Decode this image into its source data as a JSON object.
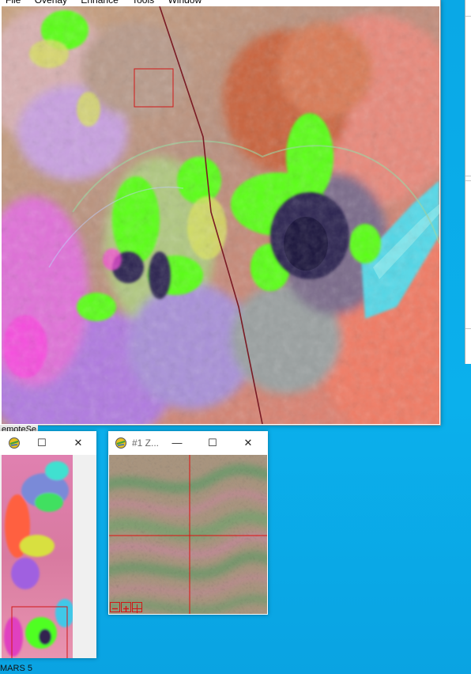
{
  "menu": {
    "items": [
      "File",
      "Overlay",
      "Enhance",
      "Tools",
      "Window"
    ]
  },
  "scroll_window": {
    "controls": {
      "minimize": "—",
      "maximize": "☐",
      "close": "✕"
    }
  },
  "zoom_window": {
    "title": "#1 Z...",
    "controls": {
      "minimize": "—",
      "maximize": "☐",
      "close": "✕"
    }
  },
  "labels": {
    "remote": "emoteSe",
    "mars": "MARS 5"
  },
  "colors": {
    "desktop": "#0aa8e6",
    "zoom_box": "#d01818",
    "crosshair": "#e01010"
  }
}
